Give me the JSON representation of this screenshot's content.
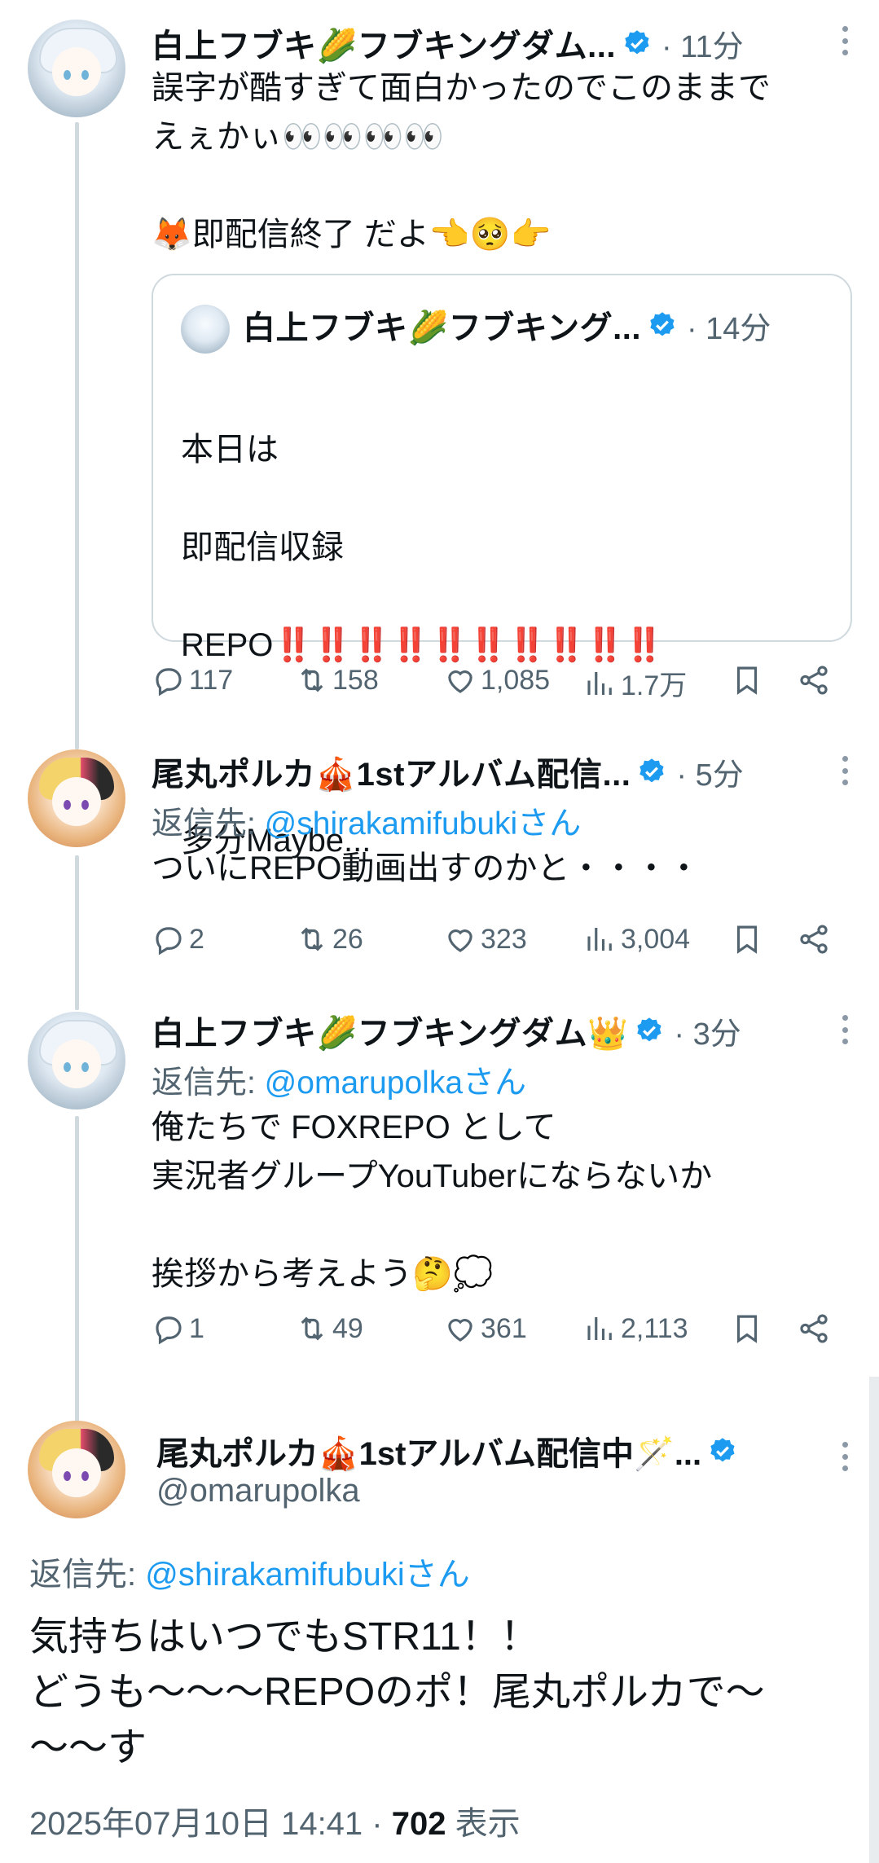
{
  "tweets": [
    {
      "name": "白上フブキ🌽フブキングダム...",
      "time": "· 11分",
      "text": "誤字が酷すぎて面白かったのでこのままで\nえぇかぃ👀👀👀👀\n\n🦊即配信終了 だよ👈🥺👉",
      "quote": {
        "name": "白上フブキ🌽フブキング...",
        "time": "· 14分",
        "lines": [
          "本日は",
          "即配信収録",
          "REPO"
        ],
        "bangs": "‼️‼️‼️‼️‼️‼️‼️‼️‼️‼️",
        "tail": "多分Maybe..."
      },
      "stats": {
        "replies": "117",
        "retweets": "158",
        "likes": "1,085",
        "views": "1.7万"
      }
    },
    {
      "name": "尾丸ポルカ🎪1stアルバム配信...",
      "time": "· 5分",
      "reply_prefix": "返信先: ",
      "reply_mention": "@shirakamifubukiさん",
      "text": "ついにREPO動画出すのかと・・・・",
      "stats": {
        "replies": "2",
        "retweets": "26",
        "likes": "323",
        "views": "3,004"
      }
    },
    {
      "name": "白上フブキ🌽フブキングダム👑",
      "time": "· 3分",
      "reply_prefix": "返信先: ",
      "reply_mention": "@omarupolkaさん",
      "text": "俺たちで FOXREPO として\n実況者グループYouTuberにならないか\n\n挨拶から考えよう🤔💭",
      "stats": {
        "replies": "1",
        "retweets": "49",
        "likes": "361",
        "views": "2,113"
      }
    }
  ],
  "focus": {
    "name": "尾丸ポルカ🎪1stアルバム配信中🪄...",
    "handle": "@omarupolka",
    "reply_prefix": "返信先: ",
    "reply_mention": "@shirakamifubukiさん",
    "text": "気持ちはいつでもSTR11！！\nどうも〜〜〜REPOのポ！尾丸ポルカで〜\n〜〜す",
    "timestamp": "2025年07月10日 14:41 · ",
    "views_count": "702",
    "views_label": " 表示"
  },
  "colors": {
    "accent": "#1d9bf0",
    "muted": "#536471",
    "divider": "#cfd9de",
    "bang": "#e0245e"
  },
  "icons": [
    "reply-icon",
    "retweet-icon",
    "like-icon",
    "views-icon",
    "bookmark-icon",
    "share-icon",
    "verified-icon",
    "more-icon"
  ]
}
